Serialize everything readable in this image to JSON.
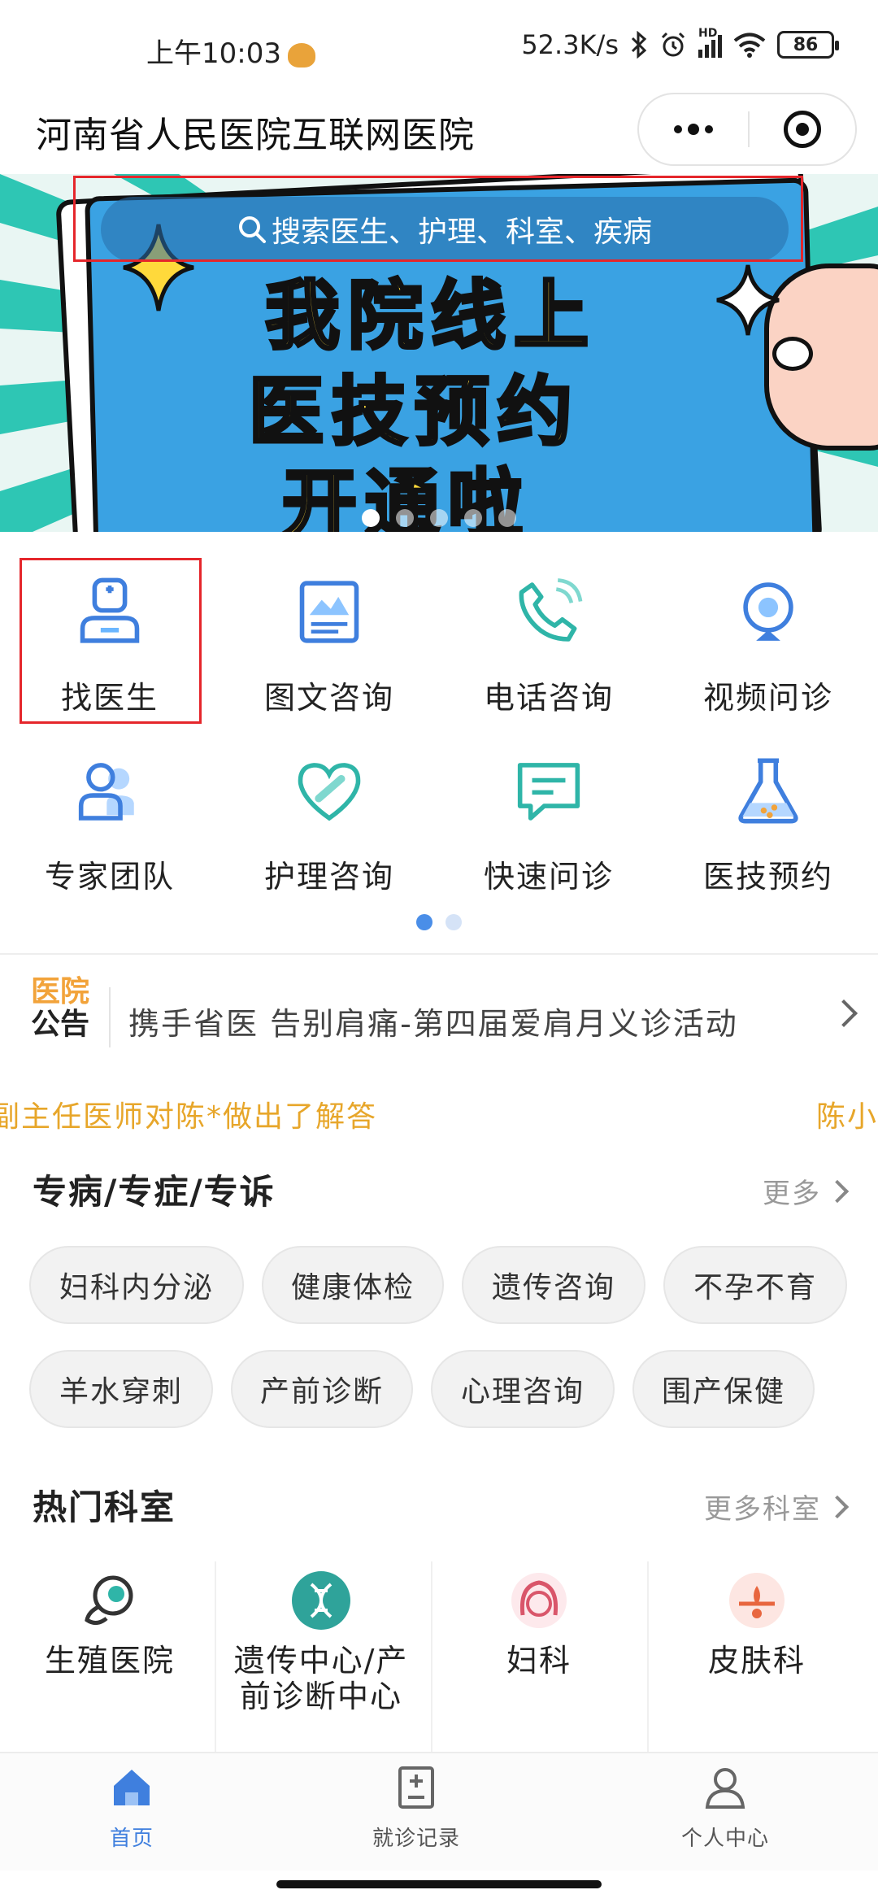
{
  "status_bar": {
    "time": "上午10:03",
    "network_speed": "52.3K/s",
    "signal_label": "HD",
    "battery": "86"
  },
  "header": {
    "title": "河南省人民医院互联网医院"
  },
  "banner": {
    "search_placeholder": "搜索医生、护理、科室、疾病",
    "headline_line1": "我院线上",
    "headline_line2": "医技预约",
    "headline_line3": "开通啦",
    "slide_count": 5,
    "active_slide": 1
  },
  "services": {
    "items": [
      {
        "label": "找医生",
        "icon": "doctor-icon"
      },
      {
        "label": "图文咨询",
        "icon": "image-text-icon"
      },
      {
        "label": "电话咨询",
        "icon": "phone-icon"
      },
      {
        "label": "视频问诊",
        "icon": "video-camera-icon"
      },
      {
        "label": "专家团队",
        "icon": "expert-team-icon"
      },
      {
        "label": "护理咨询",
        "icon": "heart-icon"
      },
      {
        "label": "快速问诊",
        "icon": "chat-icon"
      },
      {
        "label": "医技预约",
        "icon": "flask-icon"
      }
    ],
    "page_count": 2,
    "active_page": 1
  },
  "notice": {
    "badge_line1": "医院",
    "badge_line2": "公告",
    "text": "携手省医 告别肩痛-第四届爱肩月义诊活动"
  },
  "ticker": {
    "text1": "副主任医师对陈*做出了解答",
    "text2": "陈小"
  },
  "specialties": {
    "title": "专病/专症/专诉",
    "more": "更多",
    "tags": [
      "妇科内分泌",
      "健康体检",
      "遗传咨询",
      "不孕不育",
      "羊水穿刺",
      "产前诊断",
      "心理咨询",
      "围产保健"
    ]
  },
  "departments": {
    "title": "热门科室",
    "more": "更多科室",
    "items": [
      {
        "label": "生殖医院",
        "icon": "reproductive-icon"
      },
      {
        "label": "遗传中心/产前诊断中心",
        "icon": "dna-icon"
      },
      {
        "label": "妇科",
        "icon": "woman-icon"
      },
      {
        "label": "皮肤科",
        "icon": "skin-icon"
      }
    ]
  },
  "tab_bar": {
    "tabs": [
      {
        "label": "首页",
        "icon": "home-icon",
        "active": true
      },
      {
        "label": "就诊记录",
        "icon": "record-icon",
        "active": false
      },
      {
        "label": "个人中心",
        "icon": "user-icon",
        "active": false
      }
    ]
  },
  "colors": {
    "accent_blue": "#3f7fde",
    "notice_orange": "#f2a33a",
    "ticker_gold": "#e7a62a",
    "banner_blue": "#3aa2e3",
    "banner_yellow": "#ffd93b",
    "highlight_red": "#e5262b"
  }
}
